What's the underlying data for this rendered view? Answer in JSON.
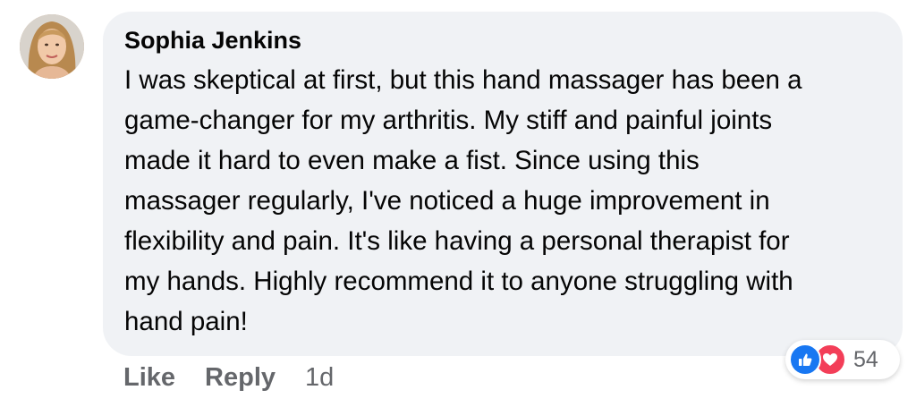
{
  "comment": {
    "author": "Sophia Jenkins",
    "lines": [
      "I was skeptical at first, but this hand massager has been a",
      "game-changer for my arthritis. My stiff and painful joints",
      "made it hard to even make a fist. Since using this",
      "massager regularly, I've noticed a huge improvement in",
      "flexibility and pain. It's like having a personal therapist for",
      "my hands. Highly recommend it to anyone struggling with",
      "hand pain!"
    ]
  },
  "actions": {
    "like_label": "Like",
    "reply_label": "Reply",
    "time": "1d"
  },
  "reactions": {
    "icons": [
      "like-icon",
      "love-icon"
    ],
    "count": "54",
    "colors": {
      "like": "#1877f2",
      "love": "#f33e58"
    }
  },
  "theme": {
    "bubble_bg": "#f0f2f5",
    "muted_text": "#65676b"
  }
}
